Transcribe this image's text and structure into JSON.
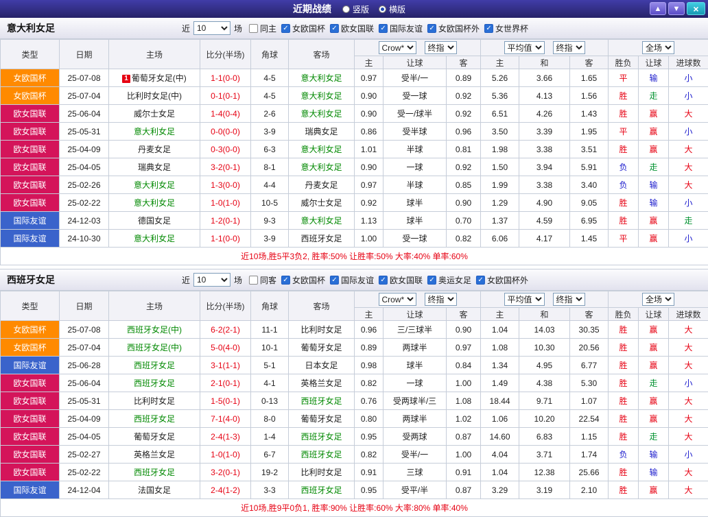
{
  "titlebar": {
    "title": "近期战绩",
    "view_options": [
      {
        "label": "竖版",
        "selected": false
      },
      {
        "label": "横版",
        "selected": true
      }
    ],
    "up_button": "▲",
    "down_button": "▼",
    "close_button": "×"
  },
  "colors": {
    "focal_team": "#008800",
    "score": "#e60012",
    "summary": "#e60012",
    "result_red": "#e60012",
    "result_blue": "#1a1acc",
    "result_green": "#00912f"
  },
  "type_colors": {
    "女欧国杯": "#ff8a00",
    "欧女国联": "#d4145a",
    "国际友谊": "#3a63cb"
  },
  "header": {
    "static_cols": [
      "类型",
      "日期",
      "主场",
      "比分(半场)",
      "角球",
      "客场"
    ],
    "groups": [
      {
        "selects": [
          "Crow*",
          "终指"
        ],
        "subs": [
          "主",
          "让球",
          "客"
        ]
      },
      {
        "selects": [
          "平均值",
          "终指"
        ],
        "subs": [
          "主",
          "和",
          "客"
        ]
      },
      {
        "selects": [
          "全场"
        ],
        "subs": [
          "胜负",
          "让球",
          "进球数"
        ]
      }
    ]
  },
  "sections": [
    {
      "team": "意大利女足",
      "filter": {
        "near_label": "近",
        "count_select": "10",
        "games_label": "场",
        "checkboxes": [
          {
            "label": "同主",
            "checked": false
          },
          {
            "label": "女欧国杯",
            "checked": true
          },
          {
            "label": "欧女国联",
            "checked": true
          },
          {
            "label": "国际友谊",
            "checked": true
          },
          {
            "label": "女欧国杯外",
            "checked": true
          },
          {
            "label": "女世界杯",
            "checked": true
          }
        ]
      },
      "rows": [
        {
          "type": "女欧国杯",
          "date": "25-07-08",
          "home": "葡萄牙女足(中)",
          "home_focal": false,
          "home_card": "1",
          "score": "1-1(0-0)",
          "corners": "4-5",
          "away": "意大利女足",
          "away_focal": true,
          "odds": [
            "0.97",
            "受半/一",
            "0.89"
          ],
          "avg": [
            "5.26",
            "3.66",
            "1.65"
          ],
          "results": [
            [
              "平",
              "red"
            ],
            [
              "输",
              "blue"
            ],
            [
              "小",
              "blue"
            ]
          ]
        },
        {
          "type": "女欧国杯",
          "date": "25-07-04",
          "home": "比利时女足(中)",
          "home_focal": false,
          "home_card": "",
          "score": "0-1(0-1)",
          "corners": "4-5",
          "away": "意大利女足",
          "away_focal": true,
          "odds": [
            "0.90",
            "受一球",
            "0.92"
          ],
          "avg": [
            "5.36",
            "4.13",
            "1.56"
          ],
          "results": [
            [
              "胜",
              "red"
            ],
            [
              "走",
              "green"
            ],
            [
              "小",
              "blue"
            ]
          ]
        },
        {
          "type": "欧女国联",
          "date": "25-06-04",
          "home": "威尔士女足",
          "home_focal": false,
          "home_card": "",
          "score": "1-4(0-4)",
          "corners": "2-6",
          "away": "意大利女足",
          "away_focal": true,
          "odds": [
            "0.90",
            "受一/球半",
            "0.92"
          ],
          "avg": [
            "6.51",
            "4.26",
            "1.43"
          ],
          "results": [
            [
              "胜",
              "red"
            ],
            [
              "赢",
              "red"
            ],
            [
              "大",
              "red"
            ]
          ]
        },
        {
          "type": "欧女国联",
          "date": "25-05-31",
          "home": "意大利女足",
          "home_focal": true,
          "home_card": "",
          "score": "0-0(0-0)",
          "corners": "3-9",
          "away": "瑞典女足",
          "away_focal": false,
          "odds": [
            "0.86",
            "受半球",
            "0.96"
          ],
          "avg": [
            "3.50",
            "3.39",
            "1.95"
          ],
          "results": [
            [
              "平",
              "red"
            ],
            [
              "赢",
              "red"
            ],
            [
              "小",
              "blue"
            ]
          ]
        },
        {
          "type": "欧女国联",
          "date": "25-04-09",
          "home": "丹麦女足",
          "home_focal": false,
          "home_card": "",
          "score": "0-3(0-0)",
          "corners": "6-3",
          "away": "意大利女足",
          "away_focal": true,
          "odds": [
            "1.01",
            "半球",
            "0.81"
          ],
          "avg": [
            "1.98",
            "3.38",
            "3.51"
          ],
          "results": [
            [
              "胜",
              "red"
            ],
            [
              "赢",
              "red"
            ],
            [
              "大",
              "red"
            ]
          ]
        },
        {
          "type": "欧女国联",
          "date": "25-04-05",
          "home": "瑞典女足",
          "home_focal": false,
          "home_card": "",
          "score": "3-2(0-1)",
          "corners": "8-1",
          "away": "意大利女足",
          "away_focal": true,
          "odds": [
            "0.90",
            "一球",
            "0.92"
          ],
          "avg": [
            "1.50",
            "3.94",
            "5.91"
          ],
          "results": [
            [
              "负",
              "blue"
            ],
            [
              "走",
              "green"
            ],
            [
              "大",
              "red"
            ]
          ]
        },
        {
          "type": "欧女国联",
          "date": "25-02-26",
          "home": "意大利女足",
          "home_focal": true,
          "home_card": "",
          "score": "1-3(0-0)",
          "corners": "4-4",
          "away": "丹麦女足",
          "away_focal": false,
          "odds": [
            "0.97",
            "半球",
            "0.85"
          ],
          "avg": [
            "1.99",
            "3.38",
            "3.40"
          ],
          "results": [
            [
              "负",
              "blue"
            ],
            [
              "输",
              "blue"
            ],
            [
              "大",
              "red"
            ]
          ]
        },
        {
          "type": "欧女国联",
          "date": "25-02-22",
          "home": "意大利女足",
          "home_focal": true,
          "home_card": "",
          "score": "1-0(1-0)",
          "corners": "10-5",
          "away": "威尔士女足",
          "away_focal": false,
          "odds": [
            "0.92",
            "球半",
            "0.90"
          ],
          "avg": [
            "1.29",
            "4.90",
            "9.05"
          ],
          "results": [
            [
              "胜",
              "red"
            ],
            [
              "输",
              "blue"
            ],
            [
              "小",
              "blue"
            ]
          ]
        },
        {
          "type": "国际友谊",
          "date": "24-12-03",
          "home": "德国女足",
          "home_focal": false,
          "home_card": "",
          "score": "1-2(0-1)",
          "corners": "9-3",
          "away": "意大利女足",
          "away_focal": true,
          "odds": [
            "1.13",
            "球半",
            "0.70"
          ],
          "avg": [
            "1.37",
            "4.59",
            "6.95"
          ],
          "results": [
            [
              "胜",
              "red"
            ],
            [
              "赢",
              "red"
            ],
            [
              "走",
              "green"
            ]
          ]
        },
        {
          "type": "国际友谊",
          "date": "24-10-30",
          "home": "意大利女足",
          "home_focal": true,
          "home_card": "",
          "score": "1-1(0-0)",
          "corners": "3-9",
          "away": "西班牙女足",
          "away_focal": false,
          "odds": [
            "1.00",
            "受一球",
            "0.82"
          ],
          "avg": [
            "6.06",
            "4.17",
            "1.45"
          ],
          "results": [
            [
              "平",
              "red"
            ],
            [
              "赢",
              "red"
            ],
            [
              "小",
              "blue"
            ]
          ]
        }
      ],
      "summary": "近10场,胜5平3负2, 胜率:50% 让胜率:50% 大率:40% 单率:60%"
    },
    {
      "team": "西班牙女足",
      "filter": {
        "near_label": "近",
        "count_select": "10",
        "games_label": "场",
        "checkboxes": [
          {
            "label": "同客",
            "checked": false
          },
          {
            "label": "女欧国杯",
            "checked": true
          },
          {
            "label": "国际友谊",
            "checked": true
          },
          {
            "label": "欧女国联",
            "checked": true
          },
          {
            "label": "奥运女足",
            "checked": true
          },
          {
            "label": "女欧国杯外",
            "checked": true
          }
        ]
      },
      "rows": [
        {
          "type": "女欧国杯",
          "date": "25-07-08",
          "home": "西班牙女足(中)",
          "home_focal": true,
          "home_card": "",
          "score": "6-2(2-1)",
          "corners": "11-1",
          "away": "比利时女足",
          "away_focal": false,
          "odds": [
            "0.96",
            "三/三球半",
            "0.90"
          ],
          "avg": [
            "1.04",
            "14.03",
            "30.35"
          ],
          "results": [
            [
              "胜",
              "red"
            ],
            [
              "赢",
              "red"
            ],
            [
              "大",
              "red"
            ]
          ]
        },
        {
          "type": "女欧国杯",
          "date": "25-07-04",
          "home": "西班牙女足(中)",
          "home_focal": true,
          "home_card": "",
          "score": "5-0(4-0)",
          "corners": "10-1",
          "away": "葡萄牙女足",
          "away_focal": false,
          "odds": [
            "0.89",
            "两球半",
            "0.97"
          ],
          "avg": [
            "1.08",
            "10.30",
            "20.56"
          ],
          "results": [
            [
              "胜",
              "red"
            ],
            [
              "赢",
              "red"
            ],
            [
              "大",
              "red"
            ]
          ]
        },
        {
          "type": "国际友谊",
          "date": "25-06-28",
          "home": "西班牙女足",
          "home_focal": true,
          "home_card": "",
          "score": "3-1(1-1)",
          "corners": "5-1",
          "away": "日本女足",
          "away_focal": false,
          "odds": [
            "0.98",
            "球半",
            "0.84"
          ],
          "avg": [
            "1.34",
            "4.95",
            "6.77"
          ],
          "results": [
            [
              "胜",
              "red"
            ],
            [
              "赢",
              "red"
            ],
            [
              "大",
              "red"
            ]
          ]
        },
        {
          "type": "欧女国联",
          "date": "25-06-04",
          "home": "西班牙女足",
          "home_focal": true,
          "home_card": "",
          "score": "2-1(0-1)",
          "corners": "4-1",
          "away": "英格兰女足",
          "away_focal": false,
          "odds": [
            "0.82",
            "一球",
            "1.00"
          ],
          "avg": [
            "1.49",
            "4.38",
            "5.30"
          ],
          "results": [
            [
              "胜",
              "red"
            ],
            [
              "走",
              "green"
            ],
            [
              "小",
              "blue"
            ]
          ]
        },
        {
          "type": "欧女国联",
          "date": "25-05-31",
          "home": "比利时女足",
          "home_focal": false,
          "home_card": "",
          "score": "1-5(0-1)",
          "corners": "0-13",
          "away": "西班牙女足",
          "away_focal": true,
          "odds": [
            "0.76",
            "受两球半/三",
            "1.08"
          ],
          "avg": [
            "18.44",
            "9.71",
            "1.07"
          ],
          "results": [
            [
              "胜",
              "red"
            ],
            [
              "赢",
              "red"
            ],
            [
              "大",
              "red"
            ]
          ]
        },
        {
          "type": "欧女国联",
          "date": "25-04-09",
          "home": "西班牙女足",
          "home_focal": true,
          "home_card": "",
          "score": "7-1(4-0)",
          "corners": "8-0",
          "away": "葡萄牙女足",
          "away_focal": false,
          "odds": [
            "0.80",
            "两球半",
            "1.02"
          ],
          "avg": [
            "1.06",
            "10.20",
            "22.54"
          ],
          "results": [
            [
              "胜",
              "red"
            ],
            [
              "赢",
              "red"
            ],
            [
              "大",
              "red"
            ]
          ]
        },
        {
          "type": "欧女国联",
          "date": "25-04-05",
          "home": "葡萄牙女足",
          "home_focal": false,
          "home_card": "",
          "score": "2-4(1-3)",
          "corners": "1-4",
          "away": "西班牙女足",
          "away_focal": true,
          "odds": [
            "0.95",
            "受两球",
            "0.87"
          ],
          "avg": [
            "14.60",
            "6.83",
            "1.15"
          ],
          "results": [
            [
              "胜",
              "red"
            ],
            [
              "走",
              "green"
            ],
            [
              "大",
              "red"
            ]
          ]
        },
        {
          "type": "欧女国联",
          "date": "25-02-27",
          "home": "英格兰女足",
          "home_focal": false,
          "home_card": "",
          "score": "1-0(1-0)",
          "corners": "6-7",
          "away": "西班牙女足",
          "away_focal": true,
          "odds": [
            "0.82",
            "受半/一",
            "1.00"
          ],
          "avg": [
            "4.04",
            "3.71",
            "1.74"
          ],
          "results": [
            [
              "负",
              "blue"
            ],
            [
              "输",
              "blue"
            ],
            [
              "小",
              "blue"
            ]
          ]
        },
        {
          "type": "欧女国联",
          "date": "25-02-22",
          "home": "西班牙女足",
          "home_focal": true,
          "home_card": "",
          "score": "3-2(0-1)",
          "corners": "19-2",
          "away": "比利时女足",
          "away_focal": false,
          "odds": [
            "0.91",
            "三球",
            "0.91"
          ],
          "avg": [
            "1.04",
            "12.38",
            "25.66"
          ],
          "results": [
            [
              "胜",
              "red"
            ],
            [
              "输",
              "blue"
            ],
            [
              "大",
              "red"
            ]
          ]
        },
        {
          "type": "国际友谊",
          "date": "24-12-04",
          "home": "法国女足",
          "home_focal": false,
          "home_card": "",
          "score": "2-4(1-2)",
          "corners": "3-3",
          "away": "西班牙女足",
          "away_focal": true,
          "odds": [
            "0.95",
            "受平/半",
            "0.87"
          ],
          "avg": [
            "3.29",
            "3.19",
            "2.10"
          ],
          "results": [
            [
              "胜",
              "red"
            ],
            [
              "赢",
              "red"
            ],
            [
              "大",
              "red"
            ]
          ]
        }
      ],
      "summary": "近10场,胜9平0负1, 胜率:90% 让胜率:60% 大率:80% 单率:40%"
    }
  ]
}
